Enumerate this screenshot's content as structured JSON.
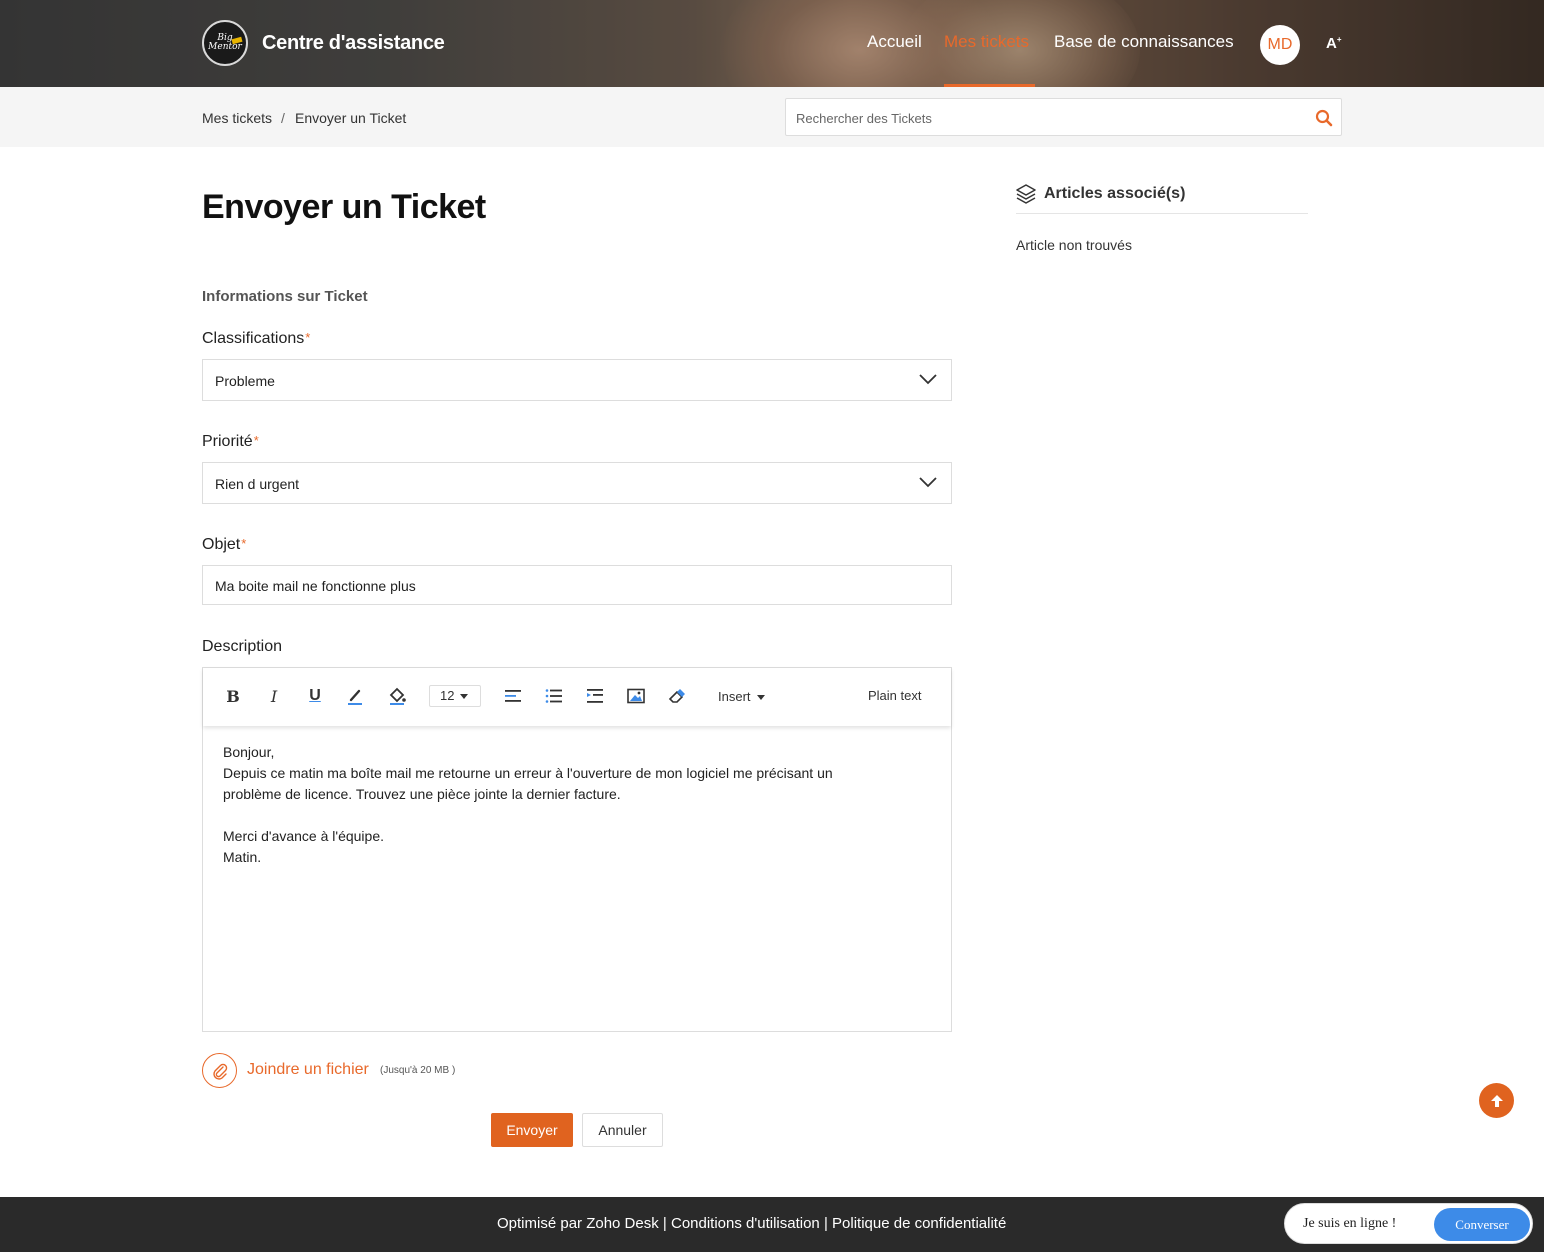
{
  "header": {
    "brand": "Centre d'assistance",
    "logo_text": "Big Mentor",
    "nav": [
      {
        "label": "Accueil",
        "active": false
      },
      {
        "label": "Mes tickets",
        "active": true
      },
      {
        "label": "Base de connaissances",
        "active": false
      }
    ],
    "avatar_initials": "MD",
    "a11y_label": "A"
  },
  "breadcrumb": {
    "items": [
      "Mes tickets",
      "Envoyer un Ticket"
    ],
    "separator": "/"
  },
  "search": {
    "placeholder": "Rechercher des Tickets",
    "value": ""
  },
  "form": {
    "title": "Envoyer un Ticket",
    "section_title": "Informations sur Ticket",
    "required_mark": "*",
    "classifications": {
      "label": "Classifications",
      "value": "Probleme"
    },
    "priority": {
      "label": "Priorité",
      "value": "Rien d urgent"
    },
    "subject": {
      "label": "Objet",
      "value": "Ma boite mail ne fonctionne plus"
    },
    "description": {
      "label": "Description",
      "font_size": "12",
      "insert_label": "Insert",
      "plain_text_label": "Plain text",
      "lines": [
        "Bonjour,",
        "Depuis ce matin ma boîte mail me retourne un erreur à l'ouverture de mon logiciel me précisant un",
        "problème de licence. Trouvez une pièce jointe la dernier facture.",
        "",
        "Merci d'avance à l'équipe.",
        "Matin."
      ]
    },
    "attach": {
      "label": "Joindre un fichier",
      "limit": "(Jusqu'à 20 MB )"
    },
    "submit_label": "Envoyer",
    "cancel_label": "Annuler"
  },
  "sidebar": {
    "title": "Articles associé(s)",
    "empty_text": "Article non trouvés"
  },
  "footer": {
    "links": [
      "Optimisé par Zoho Desk",
      "Conditions d'utilisation",
      "Politique de confidentialité"
    ],
    "separator": "|"
  },
  "chat": {
    "status": "Je suis en ligne !",
    "button_label": "Converser"
  },
  "colors": {
    "accent": "#e8692b",
    "button": "#e0631f",
    "chat_button": "#3d8be8",
    "footer": "#2a2a2a"
  }
}
